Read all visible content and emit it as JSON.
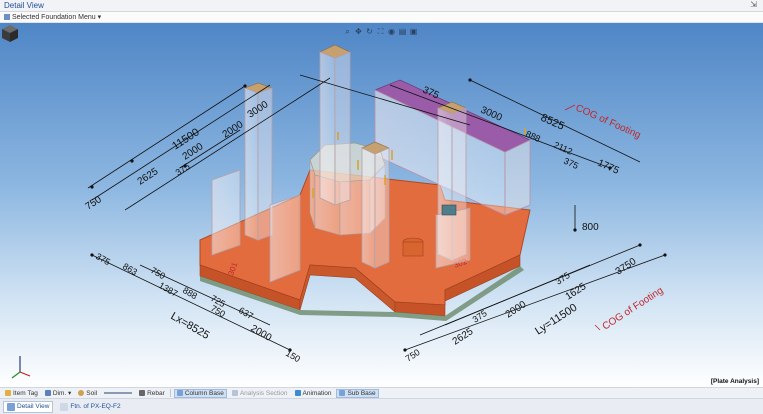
{
  "window": {
    "title": "Detail View",
    "pin_icon": "pin-icon"
  },
  "menu": {
    "label": "Selected Foundation Menu"
  },
  "view": {
    "status": "[Plate Analysis]",
    "cog_top": "COG of Footing",
    "cog_bottom": "COG of Footing",
    "dims": {
      "d11500_top": "11500",
      "d3000": "3000",
      "d2000a": "2000",
      "d2000b": "2000",
      "d2625_top": "2625",
      "d375a": "375",
      "d750_top": "750",
      "d375_tr": "375",
      "d3000_tr": "3000",
      "d8525": "8525",
      "d888_tr": "888",
      "d2112": "2112",
      "d375_tr2": "375",
      "d1775": "1775",
      "d800": "800",
      "d375_bl": "375",
      "d863": "863",
      "d750_bl": "750",
      "d1387": "1387",
      "d888_bl": "888",
      "d725": "725",
      "d750_bl2": "750",
      "d637": "637",
      "lx": "Lx=8525",
      "d2000_bl": "2000",
      "d150": "150",
      "d375_br": "375",
      "d3750": "3750",
      "d1625": "1625",
      "d375_br2": "375",
      "d2000_br": "2000",
      "ly": "Ly=11500",
      "d2625_br": "2625",
      "d750_br": "750",
      "m1": "301",
      "m2": "302"
    }
  },
  "toolbar": {
    "item_tag": "Item Tag",
    "dim": "Dim.",
    "soil": "Soil",
    "rebar": "Rebar",
    "column_base": "Column Base",
    "analysis_section": "Analysis Section",
    "animation": "Animation",
    "sub_base": "Sub Base"
  },
  "tabs": {
    "detail_view": "Detail View",
    "ftn": "Ftn. of PX-EQ-F2"
  },
  "colors": {
    "footing": "#e06a3c",
    "cog": "#c0282d",
    "purple_top": "#9a5ca8"
  }
}
